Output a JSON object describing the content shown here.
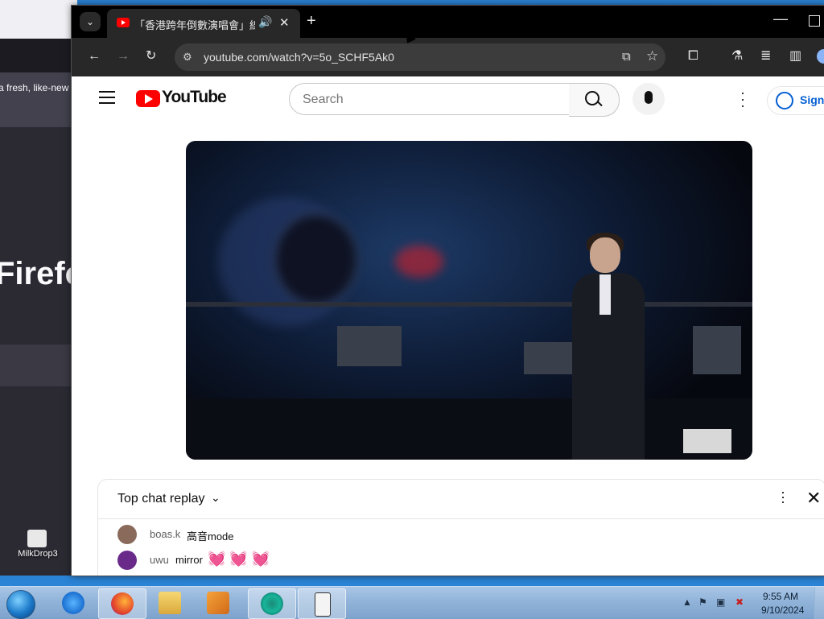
{
  "desktop": {
    "background_window": {
      "banner_text": "a fresh, like-new",
      "title_fragment": "Firefo"
    },
    "icon_label": "MilkDrop3"
  },
  "browser": {
    "tab": {
      "title": "「香港跨年倒數演唱會」線上",
      "audio_icon": "speaker-icon",
      "close_glyph": "✕"
    },
    "new_tab_glyph": "+",
    "url": "youtube.com/watch?v=5o_SCHF5Ak0",
    "window_controls": {
      "minimize_glyph": "—"
    }
  },
  "youtube": {
    "wordmark": "YouTube",
    "search": {
      "placeholder": "Search"
    },
    "signin_label": "Sign"
  },
  "chat": {
    "title": "Top chat replay",
    "messages": [
      {
        "author": "boas.k",
        "text": "高音mode",
        "avatar_color": "#8a6a5a"
      },
      {
        "author": "uwu",
        "text": "mirror",
        "emoji": "💓 💓 💓",
        "avatar_color": "#6a2a8a"
      }
    ]
  },
  "taskbar": {
    "time": "9:55 AM",
    "date": "9/10/2024"
  },
  "colors": {
    "youtube_red": "#ff0000",
    "link_blue": "#065fd4",
    "browser_dark": "#282828"
  }
}
